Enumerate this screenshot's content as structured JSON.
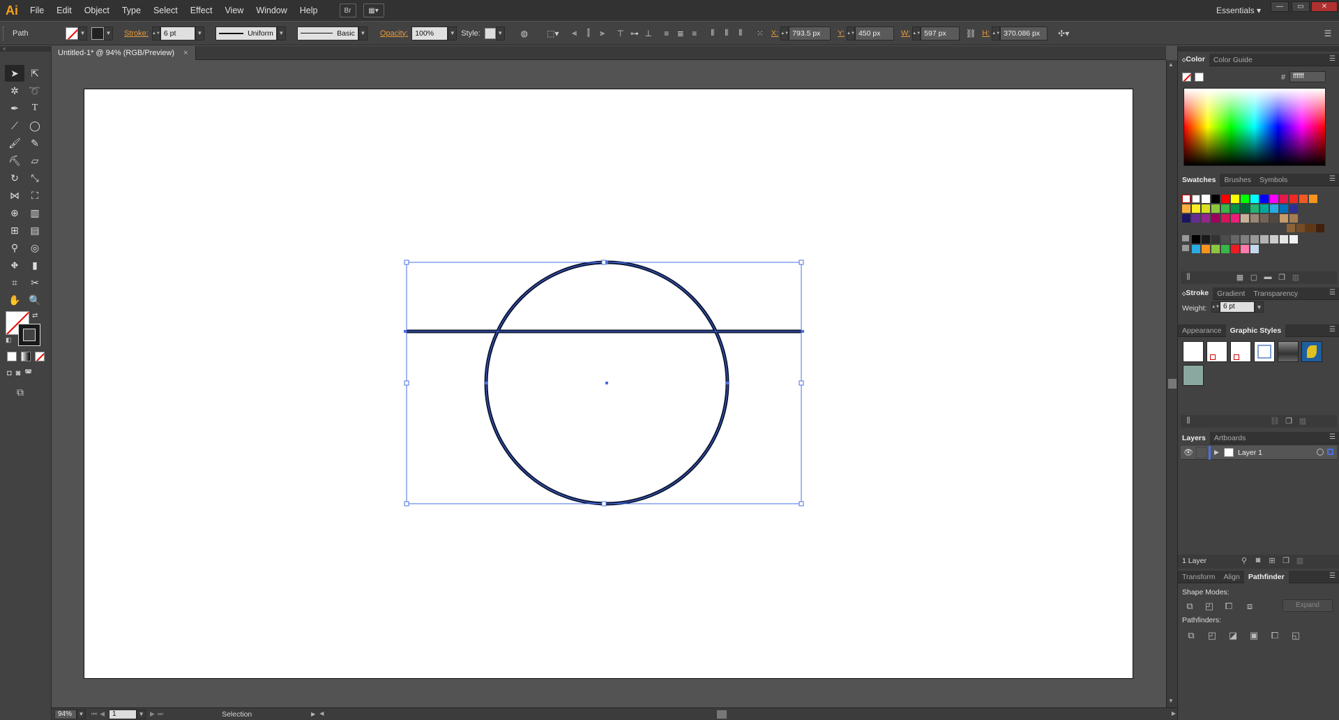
{
  "app": {
    "logo": "Ai",
    "workspace": "Essentials"
  },
  "menu": [
    "File",
    "Edit",
    "Object",
    "Type",
    "Select",
    "Effect",
    "View",
    "Window",
    "Help"
  ],
  "menubar_icons": {
    "bridge": "Br"
  },
  "window_controls": {
    "minimize": "—",
    "restore": "▭",
    "close": "✕"
  },
  "control": {
    "selection_type": "Path",
    "stroke_label": "Stroke:",
    "stroke_weight": "6 pt",
    "profile": "Uniform",
    "brush": "Basic",
    "opacity_label": "Opacity:",
    "opacity": "100%",
    "style_label": "Style:",
    "x_label": "X:",
    "x": "793.5 px",
    "y_label": "Y:",
    "y": "450 px",
    "w_label": "W:",
    "w": "597 px",
    "h_label": "H:",
    "h": "370.086 px"
  },
  "document": {
    "tab_title": "Untitled-1* @ 94% (RGB/Preview)",
    "close": "×"
  },
  "status": {
    "zoom": "94%",
    "artboard": "1",
    "tool": "Selection"
  },
  "panels": {
    "color": {
      "tabs": [
        "Color",
        "Color Guide"
      ],
      "hex_label": "#",
      "hex": "ffffff"
    },
    "swatches": {
      "tabs": [
        "Swatches",
        "Brushes",
        "Symbols"
      ]
    },
    "stroke": {
      "tabs": [
        "Stroke",
        "Gradient",
        "Transparency"
      ],
      "weight_label": "Weight:",
      "weight": "6 pt"
    },
    "appearance": {
      "tabs": [
        "Appearance",
        "Graphic Styles"
      ]
    },
    "layers": {
      "tabs": [
        "Layers",
        "Artboards"
      ],
      "layer_name": "Layer 1",
      "count": "1 Layer"
    },
    "pathfinder": {
      "tabs": [
        "Transform",
        "Align",
        "Pathfinder"
      ],
      "shape_modes": "Shape Modes:",
      "expand": "Expand",
      "pathfinders": "Pathfinders:"
    }
  },
  "colors": {
    "ui_dark": "#323232",
    "ui_mid": "#424242",
    "canvas": "#535353",
    "selection": "#4a6fe3",
    "stroke": "#0b1433",
    "accent_orange": "#f7a21b"
  },
  "swatch_colors": [
    [
      "#ffffff",
      "#000000",
      "#ff0000",
      "#ffff00",
      "#00ff00",
      "#00ffff",
      "#0000ff",
      "#ff00ff",
      "#e6194b",
      "#ee2a24",
      "#f15a24",
      "#f7931e"
    ],
    [
      "#fbb03b",
      "#fcee21",
      "#d9e021",
      "#8cc63f",
      "#39b54a",
      "#009245",
      "#006837",
      "#22b573",
      "#00a99d",
      "#29abe2",
      "#0071bc",
      "#2e3192"
    ],
    [
      "#1b1464",
      "#662d91",
      "#93278f",
      "#9e005d",
      "#d4145a",
      "#ed1e79",
      "#c7b299",
      "#998675",
      "#736357",
      "#534741",
      "#c69c6d",
      "#a67c52"
    ],
    [
      "#8c6239",
      "#754c24",
      "#603813",
      "#42210b"
    ],
    [
      "#000000",
      "#1a1a1a",
      "#333333",
      "#4d4d4d",
      "#666666",
      "#808080",
      "#999999",
      "#b3b3b3",
      "#cccccc",
      "#e6e6e6",
      "#f2f2f2"
    ],
    [
      "#29abe2",
      "#f7931e",
      "#8cc63f",
      "#39b54a",
      "#ed1c24",
      "#ff7bac",
      "#c4d9ee"
    ]
  ]
}
